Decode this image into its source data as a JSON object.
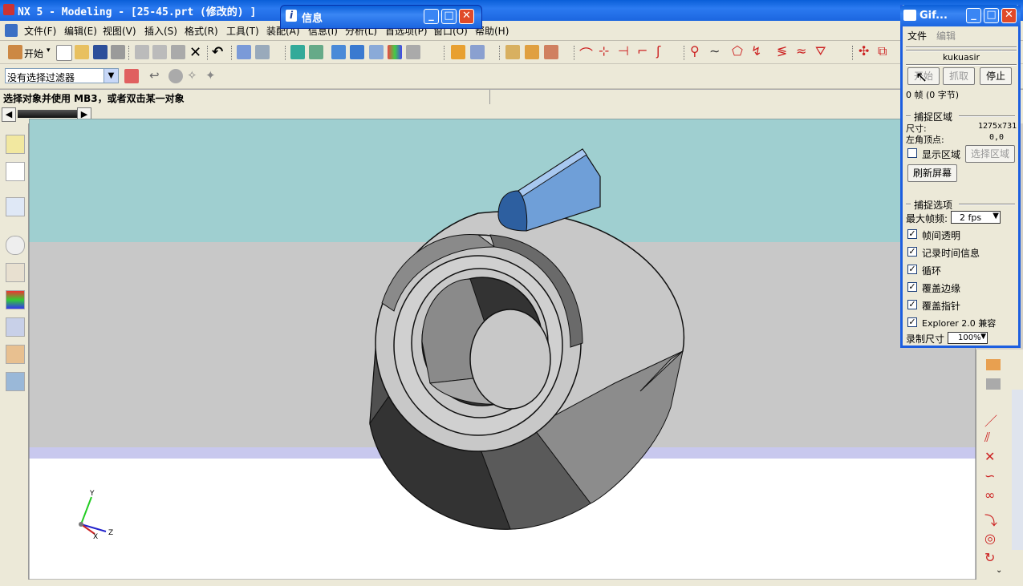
{
  "window": {
    "title": "NX 5 - Modeling - [25-45.prt  (修改的) ]"
  },
  "menu": {
    "items": [
      "文件(F)",
      "编辑(E)",
      "视图(V)",
      "插入(S)",
      "格式(R)",
      "工具(T)",
      "装配(A)",
      "信息(I)",
      "分析(L)",
      "首选项(P)",
      "窗口(O)",
      "帮助(H)"
    ]
  },
  "toolbar": {
    "start_label": "开始"
  },
  "filter": {
    "selected": "没有选择过滤器"
  },
  "status": {
    "prompt": "选择对象并使用 MB3，或者双击某一对象"
  },
  "info_window": {
    "title": "信息"
  },
  "gif_panel": {
    "title": "Gif...",
    "menu_file": "文件",
    "menu_edit": "编辑",
    "user": "kukuasir",
    "btn_start": "开始",
    "btn_capture": "抓取",
    "btn_stop": "停止",
    "frames_text": "0 帧 (0 字节)",
    "capture_area_title": "捕捉区域",
    "size_label": "尺寸:",
    "size_value": "1275x731",
    "corner_label": "左角顶点:",
    "corner_value": "0,0",
    "show_area_label": "显示区域",
    "select_area_btn": "选择区域",
    "refresh_btn": "刷新屏幕",
    "capture_opts_title": "捕捉选项",
    "max_fps_label": "最大帧频:",
    "max_fps_value": "2 fps",
    "options": [
      {
        "label": "帧间透明",
        "checked": true
      },
      {
        "label": "记录时间信息",
        "checked": true
      },
      {
        "label": "循环",
        "checked": true
      },
      {
        "label": "覆盖边缘",
        "checked": true
      },
      {
        "label": "覆盖指针",
        "checked": true
      },
      {
        "label": "Explorer 2.0 兼容",
        "checked": true
      }
    ],
    "rec_size_label": "录制尺寸",
    "rec_size_value": "100%"
  },
  "axes": {
    "x": "X",
    "y": "Y",
    "z": "Z"
  },
  "colors": {
    "titlebar": "#1c66e0",
    "viewport_top": "#9fcfd0",
    "viewport_mid": "#c8c8c8",
    "viewport_bottom": "#ffffff",
    "part_dark": "#333333",
    "part_light": "#c8c8c8",
    "handle_blue": "#6f9fd8"
  }
}
